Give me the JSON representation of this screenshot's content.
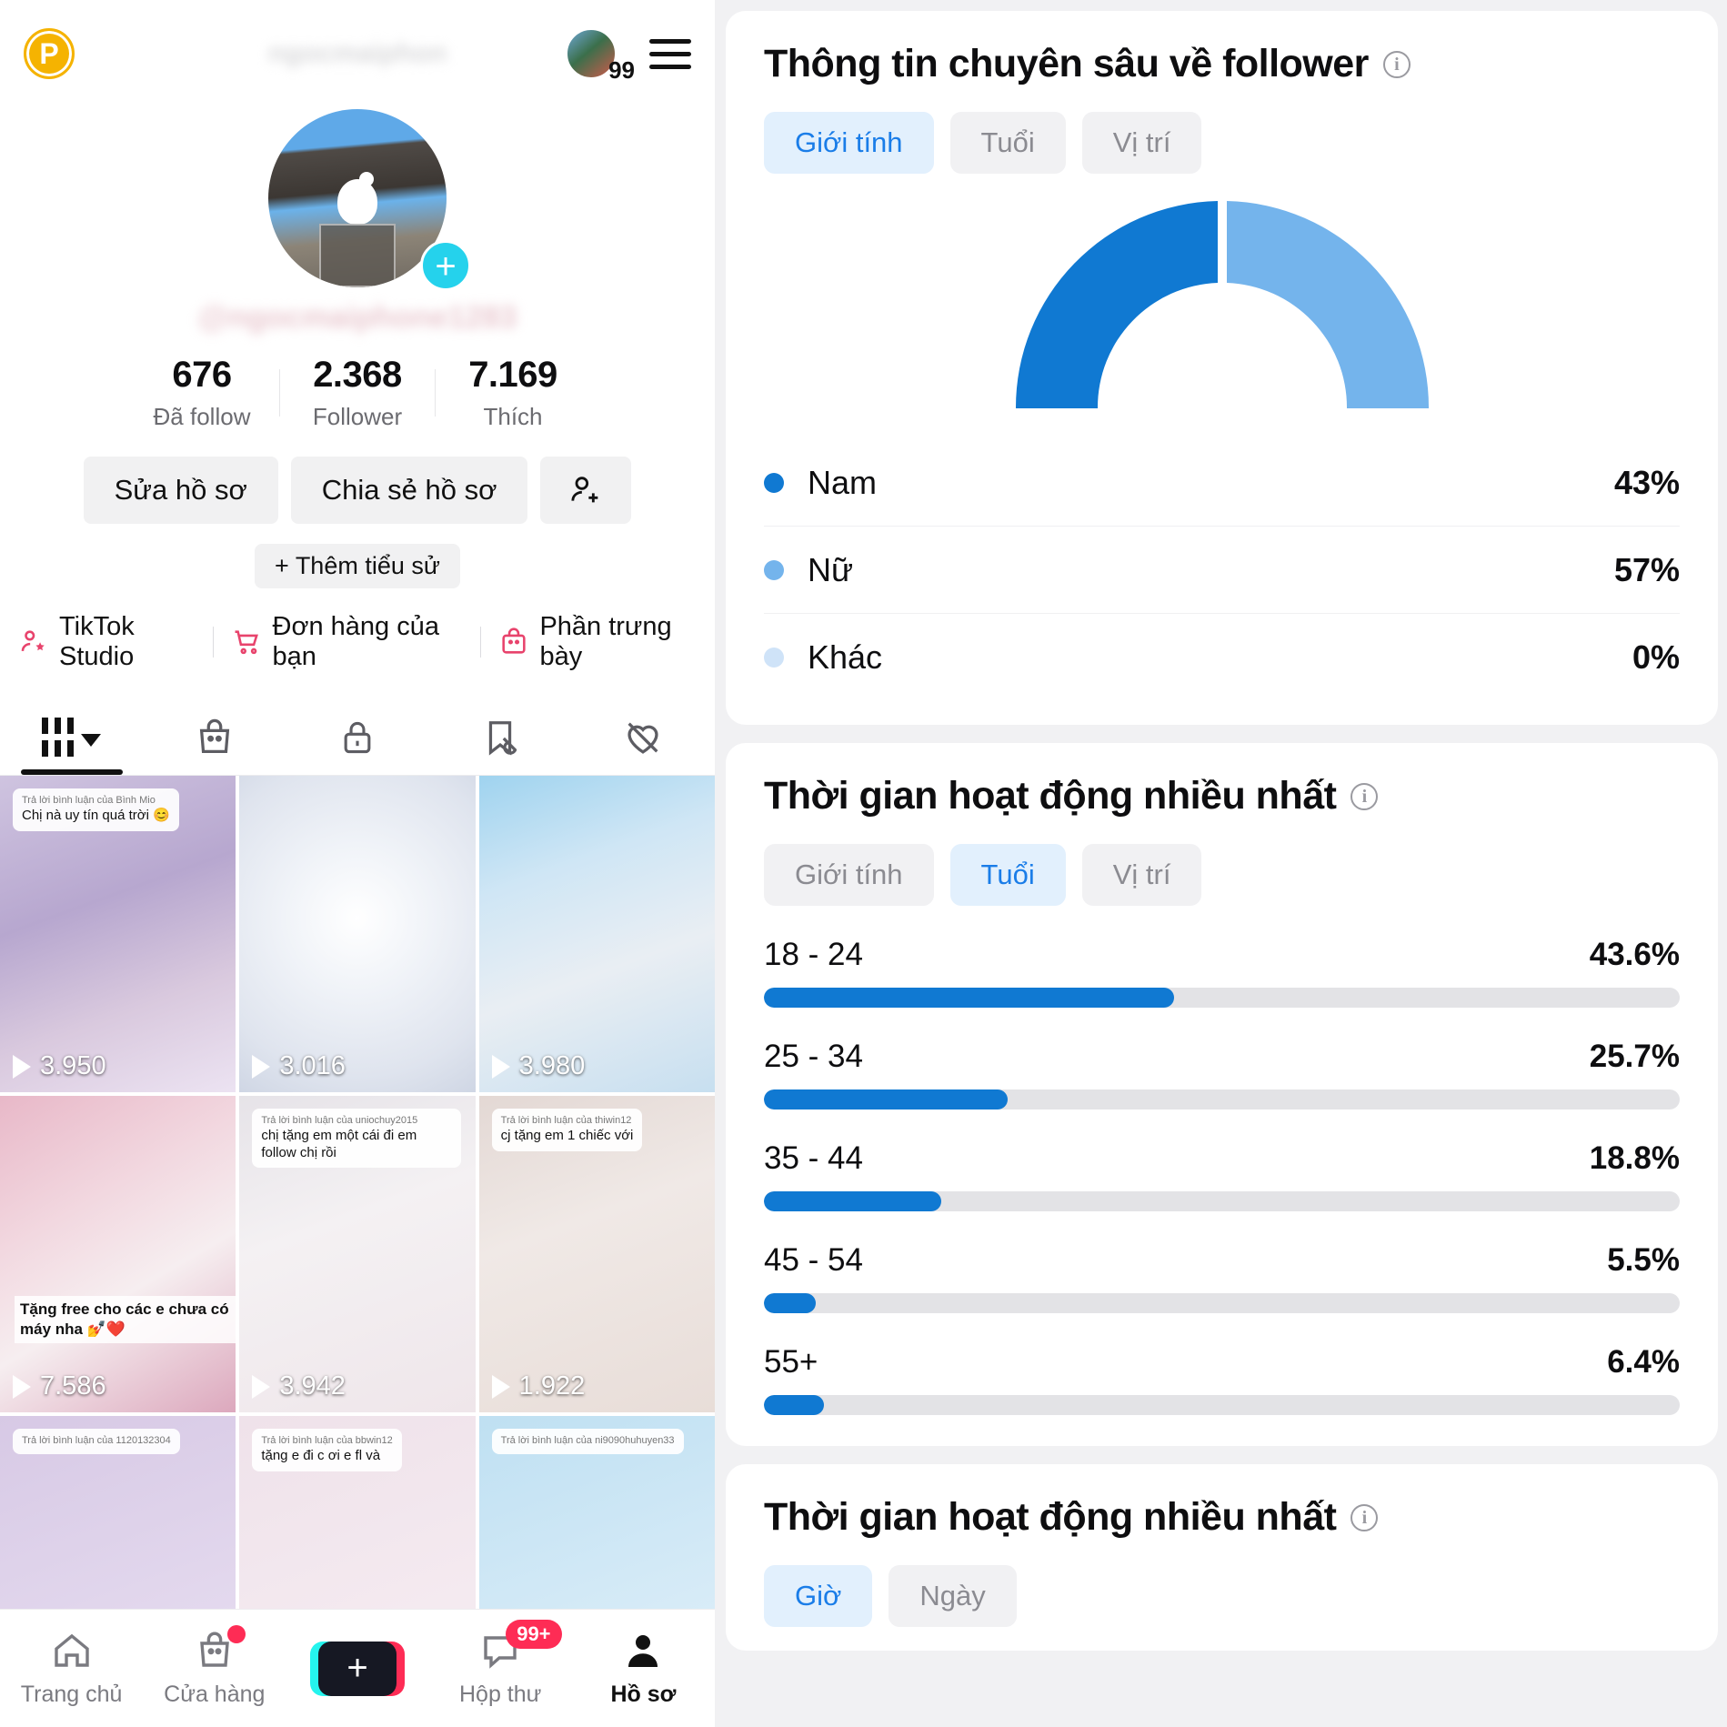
{
  "profile": {
    "pro_badge": "P",
    "blurred_title": "ngocmaiphon",
    "mini_avatar_count": "99",
    "blurred_handle": "@ngocmaiphone1283",
    "stats": [
      {
        "num": "676",
        "label": "Đã follow"
      },
      {
        "num": "2.368",
        "label": "Follower"
      },
      {
        "num": "7.169",
        "label": "Thích"
      }
    ],
    "buttons": {
      "edit": "Sửa hồ sơ",
      "share": "Chia sẻ hồ sơ",
      "add_friend_icon": "add-person-icon",
      "add_bio": "+ Thêm tiểu sử"
    },
    "shortcuts": [
      {
        "label": "TikTok Studio",
        "icon": "person-star-icon"
      },
      {
        "label": "Đơn hàng của bạn",
        "icon": "shopping-cart-icon"
      },
      {
        "label": "Phần trưng bày",
        "icon": "showcase-bag-icon"
      }
    ],
    "tabs": [
      {
        "icon": "grid-icon",
        "active": true
      },
      {
        "icon": "shopping-bag-icon",
        "active": false
      },
      {
        "icon": "lock-icon",
        "active": false
      },
      {
        "icon": "bookmark-slash-icon",
        "active": false
      },
      {
        "icon": "heart-slash-icon",
        "active": false
      }
    ],
    "videos": [
      {
        "views": "3.950",
        "comment_reply": "Trả lời bình luận của Bình Mio",
        "comment": "Chị nà uy tín quá trời 😊",
        "caption": ""
      },
      {
        "views": "3.016",
        "comment_reply": "",
        "comment": "",
        "caption": ""
      },
      {
        "views": "3.980",
        "comment_reply": "",
        "comment": "",
        "caption": ""
      },
      {
        "views": "7.586",
        "comment_reply": "",
        "comment": "",
        "caption": "Tặng free cho các e chưa có máy nha 💅❤️"
      },
      {
        "views": "3.942",
        "comment_reply": "Trả lời bình luận của uniochuy2015",
        "comment": "chị tặng em một cái đi em follow chị rồi",
        "caption": ""
      },
      {
        "views": "1.922",
        "comment_reply": "Trả lời bình luận của thiwin12",
        "comment": "cj tặng em 1 chiếc với",
        "caption": ""
      },
      {
        "views": "",
        "comment_reply": "Trả lời bình luận của 1120132304",
        "comment": "",
        "caption": ""
      },
      {
        "views": "",
        "comment_reply": "Trả lời bình luận của bbwin12",
        "comment": "tặng e đi c ơi e fl và",
        "caption": ""
      },
      {
        "views": "",
        "comment_reply": "Trả lời bình luận của ni9090huhuyen33",
        "comment": "",
        "caption": ""
      }
    ],
    "bottom_nav": [
      {
        "label": "Trang chủ",
        "icon": "home-icon",
        "badge": "",
        "active": false
      },
      {
        "label": "Cửa hàng",
        "icon": "shop-bag-icon",
        "badge": "dot",
        "active": false
      },
      {
        "label": "",
        "icon": "create-plus-icon",
        "badge": "",
        "active": false
      },
      {
        "label": "Hộp thư",
        "icon": "inbox-icon",
        "badge": "99+",
        "active": false
      },
      {
        "label": "Hồ sơ",
        "icon": "profile-person-icon",
        "badge": "",
        "active": true
      }
    ]
  },
  "analytics": {
    "follower_insights": {
      "title": "Thông tin chuyên sâu về follower",
      "info_icon": "info-icon",
      "segments": [
        {
          "label": "Giới tính",
          "active": true
        },
        {
          "label": "Tuổi",
          "active": false
        },
        {
          "label": "Vị trí",
          "active": false
        }
      ]
    },
    "active_time_age": {
      "title": "Thời gian hoạt động nhiều nhất",
      "info_icon": "info-icon",
      "segments": [
        {
          "label": "Giới tính",
          "active": false
        },
        {
          "label": "Tuổi",
          "active": true
        },
        {
          "label": "Vị trí",
          "active": false
        }
      ]
    },
    "active_time_hours": {
      "title": "Thời gian hoạt động nhiều nhất",
      "info_icon": "info-icon",
      "segments": [
        {
          "label": "Giờ",
          "active": true
        },
        {
          "label": "Ngày",
          "active": false
        }
      ]
    },
    "colors": {
      "primary_blue": "#1079d2",
      "light_blue": "#74b4ec",
      "pale_blue": "#cfe3f8",
      "track_gray": "#e3e3e6",
      "accent_pink": "#fe2c55"
    }
  },
  "chart_data": [
    {
      "type": "pie",
      "title": "Thông tin chuyên sâu về follower",
      "subtitle": "Giới tính",
      "shape": "half-donut-gauge",
      "legend_position": "below",
      "categories": [
        "Nam",
        "Nữ",
        "Khác"
      ],
      "values": [
        43,
        57,
        0
      ],
      "value_labels": [
        "43%",
        "57%",
        "0%"
      ],
      "colors": [
        "#1079d2",
        "#74b4ec",
        "#cfe3f8"
      ]
    },
    {
      "type": "bar",
      "orientation": "horizontal",
      "title": "Thời gian hoạt động nhiều nhất",
      "subtitle": "Tuổi",
      "xlabel": "",
      "ylabel": "",
      "grid": false,
      "categories": [
        "18 - 24",
        "25 - 34",
        "35 - 44",
        "45 - 54",
        "55+"
      ],
      "values": [
        43.6,
        25.7,
        18.8,
        5.5,
        6.4
      ],
      "value_labels": [
        "43.6%",
        "25.7%",
        "18.8%",
        "5.5%",
        "6.4%"
      ],
      "bar_fill_fraction": [
        0.448,
        0.266,
        0.194,
        0.057,
        0.066
      ],
      "xlim": [
        0,
        100
      ],
      "color": "#1079d2",
      "track_color": "#e3e3e6"
    }
  ]
}
